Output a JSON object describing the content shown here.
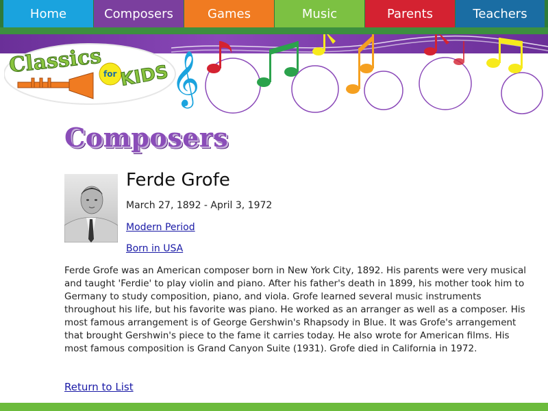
{
  "nav": {
    "items": [
      {
        "label": "Home",
        "color": "#1aa3de"
      },
      {
        "label": "Composers",
        "color": "#7b3f9e"
      },
      {
        "label": "Games",
        "color": "#f07b21"
      },
      {
        "label": "Music",
        "color": "#7cc142"
      },
      {
        "label": "Parents",
        "color": "#d42231"
      },
      {
        "label": "Teachers",
        "color": "#1a6da3"
      }
    ]
  },
  "logo": {
    "text_main": "Classics",
    "text_for": "for",
    "text_kids": "KIDS"
  },
  "page": {
    "section_title": "Composers"
  },
  "composer": {
    "name": "Ferde Grofe",
    "dates": "March 27, 1892 - April 3, 1972",
    "period_link": "Modern Period",
    "born_link": "Born in USA",
    "bio": "Ferde Grofe was an American composer born in New York City, 1892. His parents were very musical and taught 'Ferdie' to play violin and piano. After his father's death in 1899, his mother took him to Germany to study composition, piano, and viola. Grofe learned several music instruments throughout his life, but his favorite was piano. He worked as an arranger as well as a composer. His most famous arrangement is of George Gershwin's Rhapsody in Blue. It was Grofe's arrangement that brought Gershwin's piece to the fame it carries today. He also wrote for American films. His most famous composition is Grand Canyon Suite (1931). Grofe died in California in 1972."
  },
  "footer": {
    "return_link": "Return to List"
  },
  "colors": {
    "accent_purple": "#7b3f9e",
    "link_blue": "#1a1aa6",
    "footer_green": "#6cbb3c"
  }
}
